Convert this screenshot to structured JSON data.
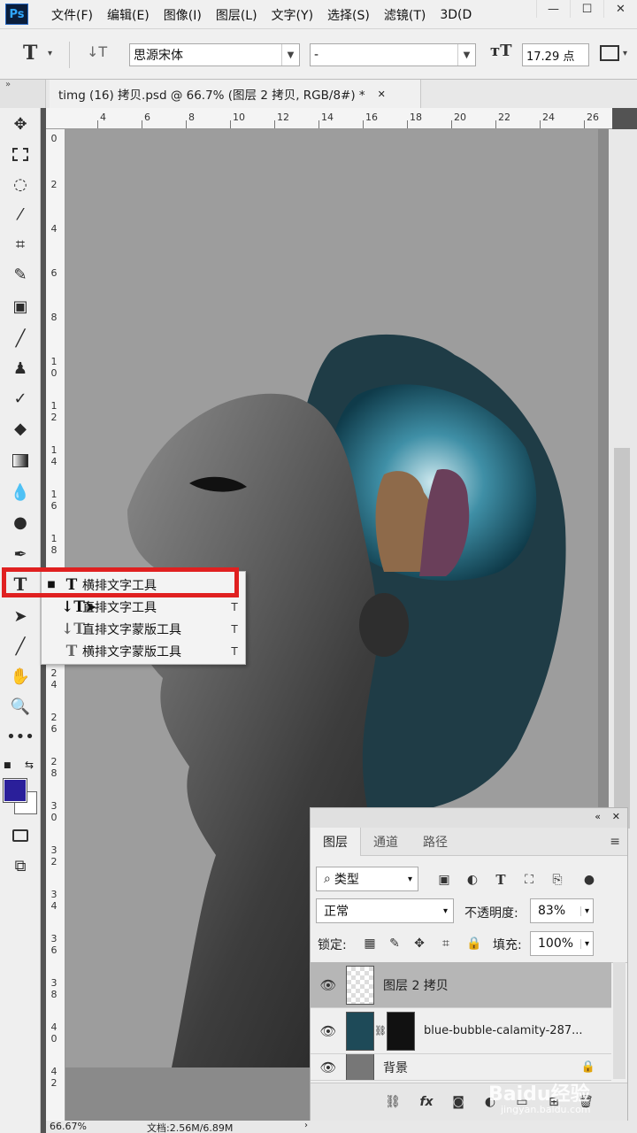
{
  "app": {
    "logo": "Ps"
  },
  "menu": [
    "文件(F)",
    "编辑(E)",
    "图像(I)",
    "图层(L)",
    "文字(Y)",
    "选择(S)",
    "滤镜(T)",
    "3D(D"
  ],
  "window_buttons": {
    "minimize": "—",
    "maximize": "☐",
    "close": "✕"
  },
  "options_bar": {
    "tool_glyph": "T",
    "orient_glyph": "↓T",
    "font_family": "思源宋体",
    "font_style": "-",
    "size_glyph": "тT",
    "font_size": "17.29 点"
  },
  "document_tab": {
    "title": "timg (16) 拷贝.psd @ 66.7% (图层 2 拷贝, RGB/8#) *",
    "close": "✕"
  },
  "ruler_h": [
    "4",
    "6",
    "8",
    "10",
    "12",
    "14",
    "16",
    "18",
    "20",
    "22",
    "24",
    "26"
  ],
  "ruler_v": [
    "0",
    "2",
    "4",
    "6",
    "8",
    "1 0",
    "1 2",
    "1 4",
    "1 6",
    "1 8",
    "2 4",
    "2 6",
    "2 8",
    "3 0",
    "3 2",
    "3 4",
    "3 6",
    "3 8",
    "4 0",
    "4 2"
  ],
  "flyout": {
    "items": [
      {
        "label": "横排文字工具",
        "key": "",
        "glyph": "T",
        "active": true
      },
      {
        "label": "直排文字工具",
        "key": "T",
        "glyph": "↓T",
        "active": false
      },
      {
        "label": "直排文字蒙版工具",
        "key": "T",
        "glyph": "↓T",
        "active": false
      },
      {
        "label": "横排文字蒙版工具",
        "key": "T",
        "glyph": "T",
        "active": false
      }
    ]
  },
  "layers_panel": {
    "tabs": [
      "图层",
      "通道",
      "路径"
    ],
    "filter_kind": "类型",
    "blend_mode": "正常",
    "opacity_label": "不透明度:",
    "opacity_value": "83%",
    "lock_label": "锁定:",
    "fill_label": "填充:",
    "fill_value": "100%",
    "layers": [
      {
        "name": "图层 2 拷贝",
        "selected": true
      },
      {
        "name": "blue-bubble-calamity-287...",
        "selected": false
      },
      {
        "name": "背景",
        "selected": false
      }
    ]
  },
  "status": {
    "zoom": "66.67%",
    "doc_info": "文档:2.56M/6.89M"
  },
  "watermark": {
    "text": "Baidu经验",
    "url": "jingyan.baidu.com"
  },
  "colors": {
    "foreground": "#2a1f9a",
    "background": "#ffffff",
    "highlight": "#e02020"
  }
}
